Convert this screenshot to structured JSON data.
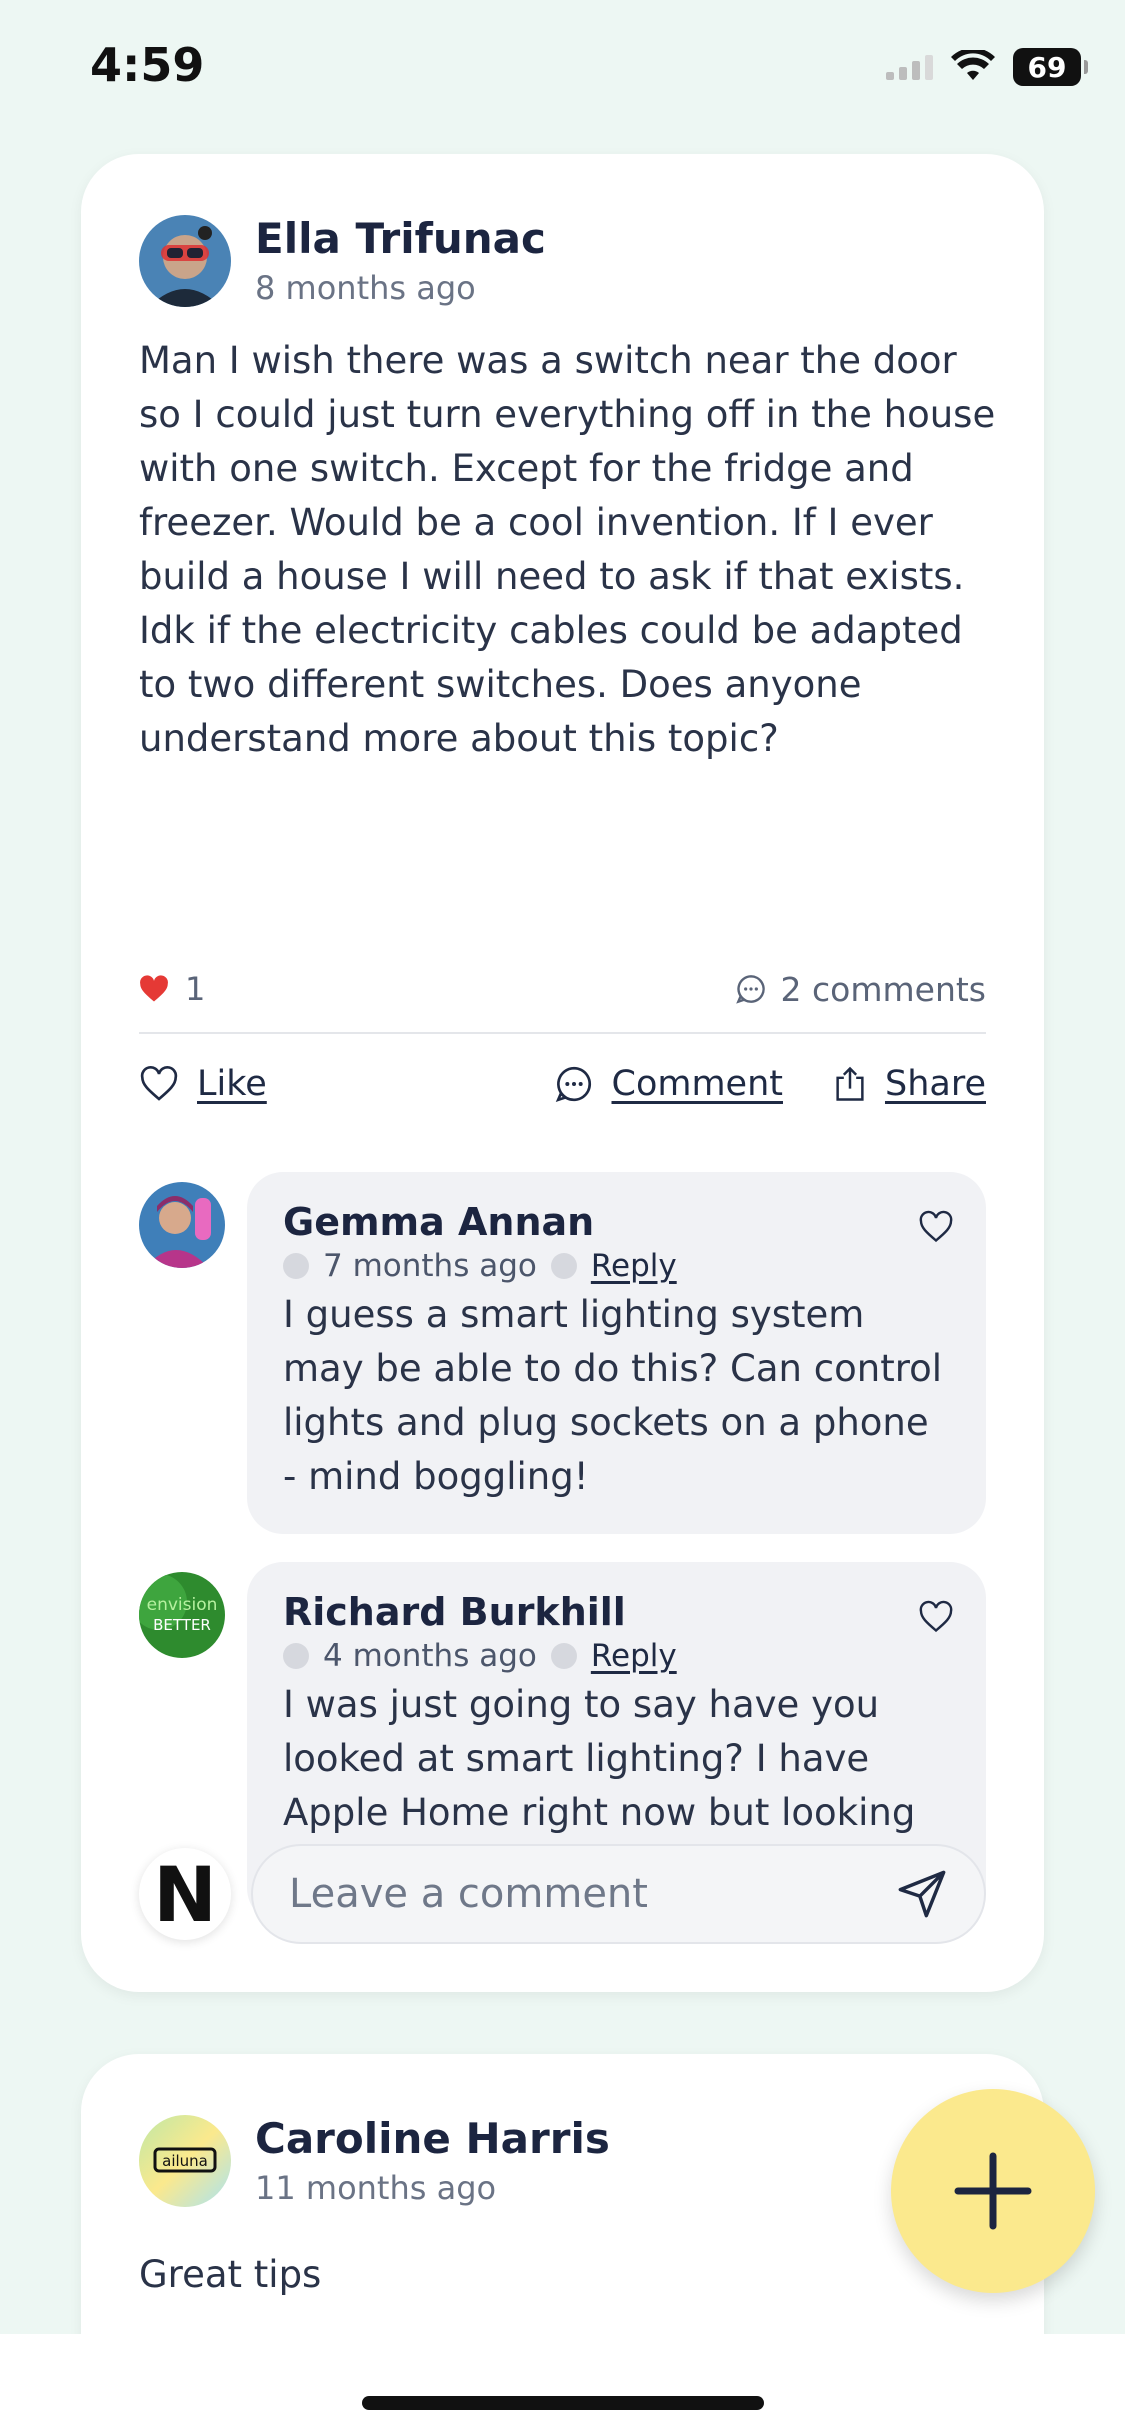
{
  "status_bar": {
    "time": "4:59",
    "battery": "69"
  },
  "post": {
    "author": "Ella Trifunac",
    "time_ago": "8 months ago",
    "text": "Man I wish there was a switch near the door so I could just turn everything off in the house with one switch. Except for the fridge and freezer. Would be a cool invention. If I ever build a house I will need to ask if that exists. Idk if the electricity cables could be adapted to two different switches. Does anyone understand more about this topic?",
    "likes": "1",
    "comments_count": "2 comments",
    "actions": {
      "like": "Like",
      "comment": "Comment",
      "share": "Share"
    }
  },
  "comments": [
    {
      "author": "Gemma Annan",
      "time_ago": "7 months ago",
      "reply": "Reply",
      "text": "I guess a smart lighting system may be able to do this? Can control lights and plug sockets on a phone - mind boggling!"
    },
    {
      "author": "Richard Burkhill",
      "time_ago": "4 months ago",
      "reply": "Reply",
      "text": "I was just going to say have you looked at smart lighting? I have Apple Home right now but looking at moving to Alexa...",
      "avatar_text": {
        "top": "envision",
        "bottom": "BETTER"
      }
    }
  ],
  "compose": {
    "placeholder": "Leave a comment",
    "avatar_letter": "N"
  },
  "next_post": {
    "author": "Caroline Harris",
    "time_ago": "11 months ago",
    "text": "Great tips",
    "avatar_text": "ailuna"
  },
  "colors": {
    "accent_like": "#e53935",
    "fab": "#fbe98d",
    "background": "#edf7f3"
  }
}
